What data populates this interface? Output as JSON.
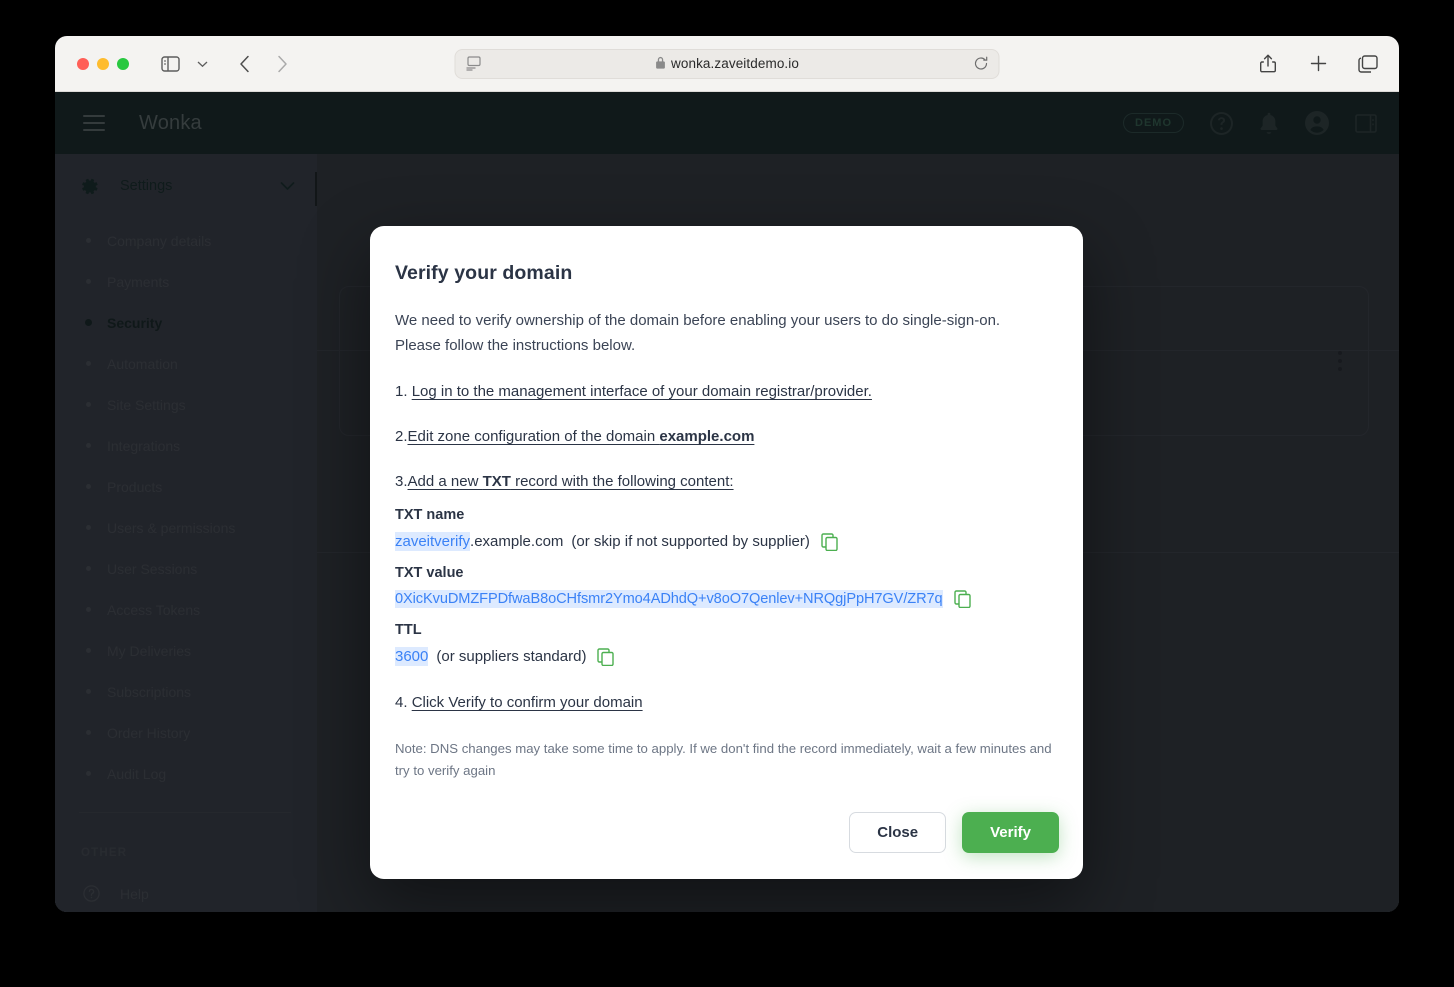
{
  "browser": {
    "url": "wonka.zaveitdemo.io",
    "lock_icon": "lock-icon",
    "reader_icon": "reader-view-icon",
    "reload_icon": "reload-icon",
    "back_icon": "back-chevron-icon",
    "forward_icon": "forward-chevron-icon",
    "sidebar_icon": "sidebar-toggle-icon",
    "sidebar_chevron_icon": "chevron-down-icon",
    "share_icon": "share-icon",
    "new_tab_icon": "plus-icon",
    "tabs_icon": "tab-overview-icon",
    "traffic_lights": [
      "close",
      "minimize",
      "zoom"
    ]
  },
  "app_header": {
    "menu_icon": "hamburger-menu-icon",
    "brand": "Wonka",
    "badge": "DEMO",
    "help_icon": "question-circle-icon",
    "bell_icon": "bell-icon",
    "account_icon": "account-circle-icon",
    "panel_icon": "right-panel-icon"
  },
  "sidebar": {
    "section_icon": "gear-icon",
    "section_label": "Settings",
    "section_chevron": "chevron-down-icon",
    "items": [
      {
        "label": "Company details",
        "active": false
      },
      {
        "label": "Payments",
        "active": false
      },
      {
        "label": "Security",
        "active": true
      },
      {
        "label": "Automation",
        "active": false
      },
      {
        "label": "Site Settings",
        "active": false
      },
      {
        "label": "Integrations",
        "active": false
      },
      {
        "label": "Products",
        "active": false
      },
      {
        "label": "Users & permissions",
        "active": false
      },
      {
        "label": "User Sessions",
        "active": false
      },
      {
        "label": "Access Tokens",
        "active": false
      },
      {
        "label": "My Deliveries",
        "active": false
      },
      {
        "label": "Subscriptions",
        "active": false
      },
      {
        "label": "Order History",
        "active": false
      },
      {
        "label": "Audit Log",
        "active": false
      }
    ],
    "other_label": "OTHER",
    "help_icon": "question-circle-icon",
    "help_label": "Help"
  },
  "background": {
    "card_kebab_icon": "kebab-menu-icon"
  },
  "modal": {
    "title": "Verify your domain",
    "intro": "We need to verify ownership of the domain before enabling your users to do single-sign-on. Please follow the instructions below.",
    "step1_num": "1.",
    "step1_text": "Log in to the management interface of your domain registrar/provider.",
    "step2_num": "2.",
    "step2_text": "Edit zone configuration of the domain ",
    "step2_domain": "example.com",
    "step3_num": "3.",
    "step3_text_a": "Add a new ",
    "step3_bold": "TXT",
    "step3_text_b": " record with the following content:",
    "txt_name_label": "TXT name",
    "txt_name_value": "zaveitverify",
    "txt_name_suffix": ".example.com",
    "txt_name_note": "(or skip if not supported by supplier)",
    "txt_value_label": "TXT value",
    "txt_value": "0XicKvuDMZFPDfwaB8oCHfsmr2Ymo4ADhdQ+v8oO7Qenlev+NRQgjPpH7GV/ZR7q",
    "ttl_label": "TTL",
    "ttl_value": "3600",
    "ttl_note": "(or suppliers standard)",
    "step4_num": "4.",
    "step4_text": "Click Verify to confirm your domain",
    "note": "Note: DNS changes may take some time to apply. If we don't find the record immediately, wait a few minutes and try to verify again",
    "close_label": "Close",
    "verify_label": "Verify",
    "copy_icon": "copy-icon"
  },
  "colors": {
    "accent_green": "#4caf50",
    "highlight_blue": "#3b82f6",
    "highlight_bg": "#ddeaff",
    "header_dark": "#0e1f1d",
    "sidebar_bg": "#343840"
  }
}
